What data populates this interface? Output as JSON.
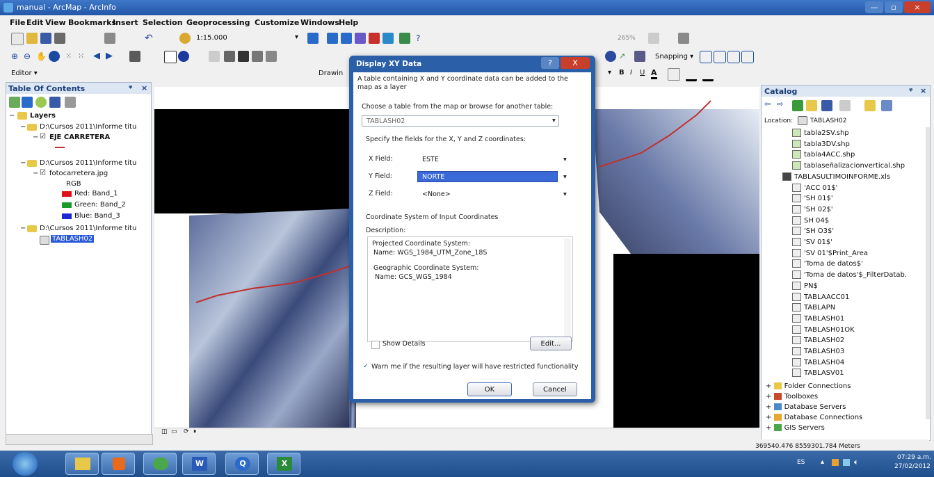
{
  "window": {
    "title": "manual - ArcMap - ArcInfo"
  },
  "menu": [
    "File",
    "Edit",
    "View",
    "Bookmarks",
    "Insert",
    "Selection",
    "Geoprocessing",
    "Customize",
    "Windows",
    "Help"
  ],
  "toolbar": {
    "scale": "1:15.000",
    "editor_label": "Editor ▾",
    "drawing_label": "Drawin",
    "snapping_label": "Snapping ▾",
    "scale_pct": "265%"
  },
  "toc": {
    "title": "Table Of Contents",
    "layers_label": "Layers",
    "items": [
      {
        "label": "D:\\Cursos 2011\\Informe titu"
      },
      {
        "label": "EJE CARRETERA"
      },
      {
        "label": "D:\\Cursos 2011\\Informe titu"
      },
      {
        "label": "fotocarretera.jpg"
      },
      {
        "label": "RGB"
      },
      {
        "label": "Red:  Band_1"
      },
      {
        "label": "Green: Band_2"
      },
      {
        "label": "Blue:  Band_3"
      },
      {
        "label": "D:\\Cursos 2011\\Informe titu"
      },
      {
        "label": "TABLASH02"
      }
    ],
    "colors": {
      "red": "#e0101a",
      "green": "#1a9a2a",
      "blue": "#1a2ad0",
      "line": "#c03030"
    }
  },
  "dialog": {
    "title": "Display XY Data",
    "intro": "A table containing X and Y coordinate data can be added to the map as a layer",
    "choose_label": "Choose a table from the map or browse for another table:",
    "table_value": "TABLASH02",
    "specify_label": "Specify the fields for the X, Y and Z coordinates:",
    "x_label": "X Field:",
    "x_value": "ESTE",
    "y_label": "Y Field:",
    "y_value": "NORTE",
    "z_label": "Z Field:",
    "z_value": "<None>",
    "coord_header": "Coordinate System of Input Coordinates",
    "description_label": "Description:",
    "proj_label": "Projected Coordinate System:",
    "proj_name": "Name: WGS_1984_UTM_Zone_18S",
    "geo_label": "Geographic Coordinate System:",
    "geo_name": "Name: GCS_WGS_1984",
    "show_details": "Show Details",
    "edit_btn": "Edit...",
    "warn_text": "Warn me if the resulting layer will have restricted functionality",
    "ok_btn": "OK",
    "cancel_btn": "Cancel",
    "help_btn": "?",
    "close_btn": "X"
  },
  "catalog": {
    "title": "Catalog",
    "location_label": "Location:",
    "location_value": "TABLASH02",
    "items": [
      "tabla2SV.shp",
      "tabla3DV.shp",
      "tabla4ACC.shp",
      "tablaseñalizacionvertical.shp",
      "TABLASULTIMOINFORME.xls",
      "'ACC 01$'",
      "'SH 01$'",
      "'SH 02$'",
      "SH 04$",
      "'SH O3$'",
      "'SV 01$'",
      "'SV 01'$Print_Area",
      "'Toma de datos$'",
      "'Toma de datos'$_FilterDatab.",
      "PN$",
      "TABLAACC01",
      "TABLAPN",
      "TABLASH01",
      "TABLASH01OK",
      "TABLASH02",
      "TABLASH03",
      "TABLASH04",
      "TABLASV01"
    ],
    "roots": [
      "Folder Connections",
      "Toolboxes",
      "Database Servers",
      "Database Connections",
      "GIS Servers"
    ]
  },
  "status": {
    "coords": "369540.476  8559301.784 Meters"
  },
  "taskbar": {
    "lang": "ES",
    "time": "07:29 a.m.",
    "date": "27/02/2012"
  }
}
